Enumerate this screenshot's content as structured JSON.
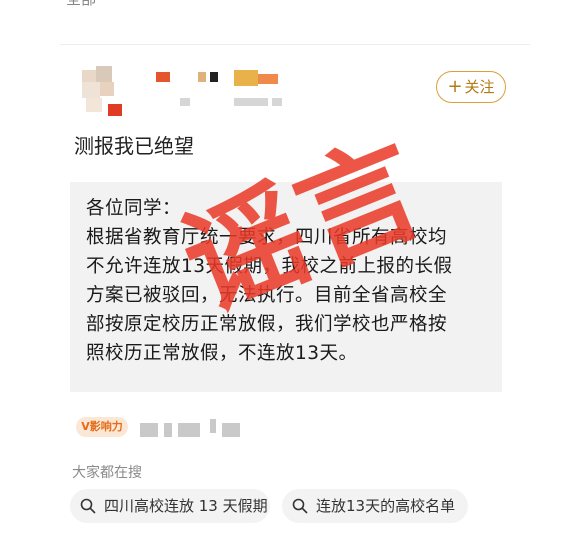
{
  "header": {
    "partial_text": "全部"
  },
  "post": {
    "title": "测报我已绝望",
    "follow_label": "关注"
  },
  "screenshot_text": {
    "lines": [
      "各位同学：",
      "根据省教育厅统一要求，四川省所有高校均",
      "不允许连放13天假期，我校之前上报的长假",
      "方案已被驳回，无法执行。目前全省高校全",
      "部按原定校历正常放假，我们学校也严格按",
      "照校历正常放假，不连放13天。"
    ]
  },
  "stamp": {
    "text": "谣言",
    "color": "#ea3a28"
  },
  "influence": {
    "badge": "V影响力"
  },
  "search": {
    "title": "大家都在搜",
    "chips": [
      "四川高校连放 13 天假期",
      "连放13天的高校名单"
    ]
  }
}
